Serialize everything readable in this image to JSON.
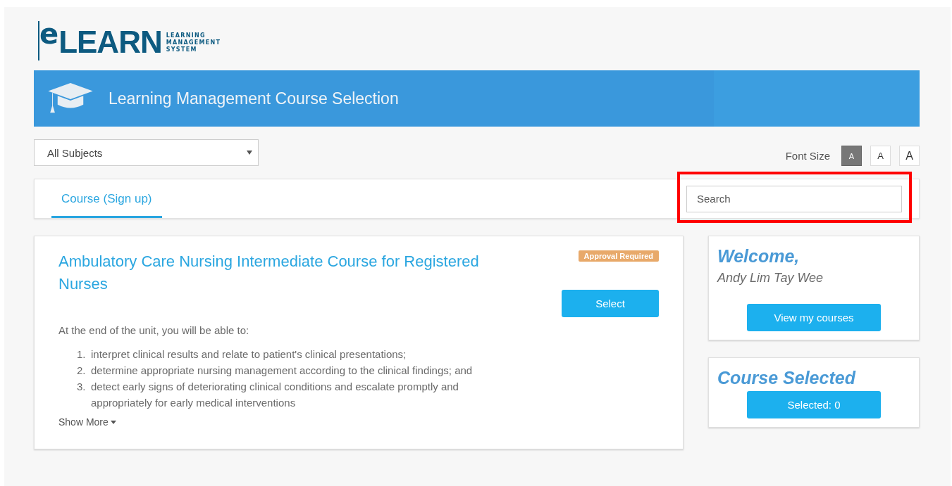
{
  "logo": {
    "mark": "e",
    "word": "LEARN",
    "tagline": [
      "LEARNING",
      "MANAGEMENT",
      "SYSTEM"
    ]
  },
  "banner": {
    "title": "Learning Management Course Selection"
  },
  "subject_filter": {
    "value": "All Subjects"
  },
  "font_size": {
    "label": "Font Size",
    "options": [
      {
        "label": "A",
        "selected": true
      },
      {
        "label": "A",
        "selected": false
      },
      {
        "label": "A",
        "selected": false
      }
    ]
  },
  "tabs": [
    {
      "label": "Course (Sign up)",
      "selected": true
    }
  ],
  "search": {
    "placeholder": "Search",
    "highlighted": true
  },
  "course": {
    "title": "Ambulatory Care Nursing Intermediate Course for Registered Nurses",
    "badge": "Approval Required",
    "button": "Select",
    "intro": "At the end of the unit, you will be able to:",
    "outcomes": [
      {
        "number": "1.",
        "text": "interpret clinical results and relate to patient's clinical presentations;"
      },
      {
        "number": "2.",
        "text": "determine appropriate nursing management according to the clinical findings; and"
      },
      {
        "number": "3.",
        "text": "detect early signs of deteriorating clinical conditions and escalate promptly and appropriately for early medical interventions"
      }
    ],
    "show_more": "Show More"
  },
  "welcome": {
    "heading": "Welcome,",
    "name": "Andy Lim Tay Wee",
    "button": "View my courses"
  },
  "selected_panel": {
    "heading": "Course Selected",
    "button": "Selected: 0"
  }
}
